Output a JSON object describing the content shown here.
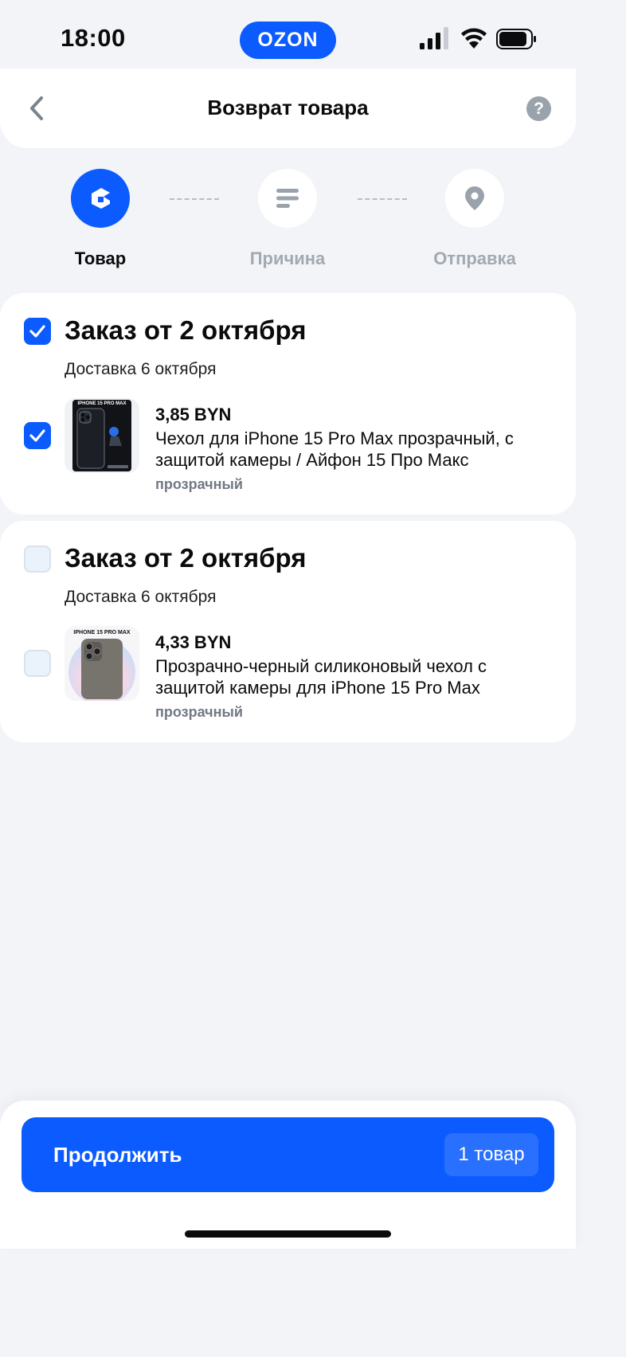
{
  "status_bar": {
    "time": "18:00",
    "logo_text": "OZON"
  },
  "header": {
    "title": "Возврат товара",
    "help_label": "?"
  },
  "stepper": {
    "steps": [
      {
        "label": "Товар",
        "icon": "box-icon",
        "state": "active"
      },
      {
        "label": "Причина",
        "icon": "list-lines-icon",
        "state": "inactive"
      },
      {
        "label": "Отправка",
        "icon": "location-pin-icon",
        "state": "inactive"
      }
    ]
  },
  "orders": [
    {
      "title": "Заказ от 2 октября",
      "delivery": "Доставка 6 октября",
      "selected": true,
      "product": {
        "price": "3,85 BYN",
        "name": "Чехол для iPhone 15 Pro Max прозрачный, с защитой камеры / Айфон 15 Про Макс",
        "variant": "прозрачный",
        "selected": true,
        "thumb_caption": "IPHONE 15 PRO MAX"
      }
    },
    {
      "title": "Заказ от 2 октября",
      "delivery": "Доставка 6 октября",
      "selected": false,
      "product": {
        "price": "4,33 BYN",
        "name": "Прозрачно-черный силиконовый чехол с защитой камеры для iPhone 15 Pro Max",
        "variant": "прозрачный",
        "selected": false,
        "thumb_caption": "IPHONE 15 PRO MAX"
      }
    }
  ],
  "footer": {
    "continue_label": "Продолжить",
    "count_label": "1 товар"
  },
  "colors": {
    "accent": "#0b5bff",
    "background": "#f2f4f8",
    "muted_text": "#a3a9b1"
  }
}
